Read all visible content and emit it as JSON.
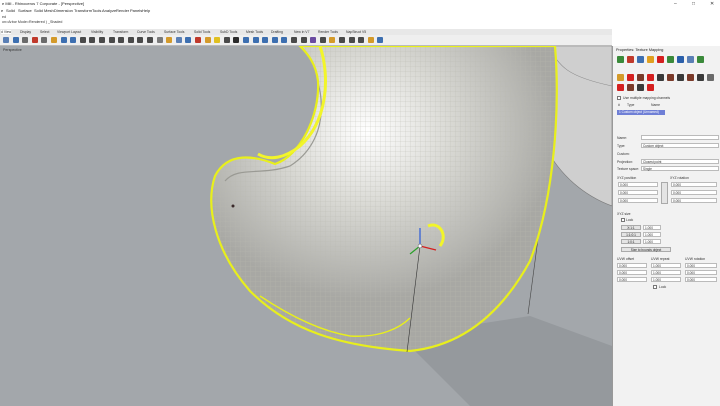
{
  "window": {
    "title": "e Mill - Rhinoceros 7 Corporate - [Perspective]",
    "controls": [
      "–",
      "□",
      "✕"
    ]
  },
  "menu": [
    "e",
    "Solid",
    "Surface",
    "Solid",
    "Mesh",
    "Dimension",
    "Transform",
    "Tools",
    "Analyze",
    "Render",
    "Panels",
    "Help"
  ],
  "command": {
    "line1": "ed",
    "line2": "on=Arbor Mode=Rendered ) _Shaded"
  },
  "tabs": [
    "d View",
    "Display",
    "Select",
    "Viewport Layout",
    "Visibility",
    "Transform",
    "Curve Tools",
    "Surface Tools",
    "Solid Tools",
    "SubD Tools",
    "Mesh Tools",
    "Drafting",
    "New in V7",
    "Render Tools",
    "NapStruct V5"
  ],
  "toolbar": {
    "icon_names": [
      "open-file-icon",
      "save-icon",
      "print-icon",
      "cut-icon",
      "copy-icon",
      "paste-icon",
      "undo-icon",
      "redo-icon",
      "pan-icon",
      "rotate-view-icon",
      "zoom-icon",
      "zoom-window-icon",
      "zoom-extents-icon",
      "zoom-selected-icon",
      "undo-view-icon",
      "four-views-icon",
      "grid-icon",
      "layer-icon",
      "properties-icon",
      "display-mode-icon",
      "render-icon",
      "material-icon",
      "light-icon",
      "filter-icon",
      "point-icon",
      "curve-icon",
      "surface-icon",
      "solid-icon",
      "mesh-icon",
      "subd-icon",
      "dimension-icon",
      "text-icon",
      "block-icon",
      "group-icon",
      "lock-icon",
      "hide-icon",
      "show-icon",
      "select-icon",
      "snap-icon",
      "gumball-icon"
    ],
    "colors": [
      "#5a7fb5",
      "#3d6fb0",
      "#6a6a6a",
      "#c0392b",
      "#6a6a6a",
      "#d49a2a",
      "#3d6fb0",
      "#3d6fb0",
      "#4a4a4a",
      "#4a4a4a",
      "#4a4a4a",
      "#4a4a4a",
      "#4a4a4a",
      "#4a4a4a",
      "#4a4a4a",
      "#4a4a4a",
      "#7a7a7a",
      "#d49a2a",
      "#5a7fb5",
      "#3d6fb0",
      "#c0392b",
      "#d49a2a",
      "#e0c020",
      "#4a4a4a",
      "#2a2a2a",
      "#3d6fb0",
      "#3d6fb0",
      "#3d6fb0",
      "#3d6fb0",
      "#3d6fb0",
      "#4a4a4a",
      "#4a4a4a",
      "#6a4aa0",
      "#4a4a4a",
      "#d49a2a",
      "#4a4a4a",
      "#4a4a4a",
      "#4a4a4a",
      "#d49a2a",
      "#3d6fb0"
    ]
  },
  "viewport": {
    "label": "Perspective"
  },
  "panel": {
    "header": "Properties: Texture Mapping",
    "row1_icons": [
      "object-icon",
      "material-icon",
      "texture-icon",
      "decal-icon",
      "sun-icon",
      "ground-icon",
      "globe-icon",
      "render-icon",
      "check-icon"
    ],
    "row1_colors": [
      "#3a8a3a",
      "#c0392b",
      "#3d6fb0",
      "#e0a020",
      "#d42020",
      "#3a8a3a",
      "#2a5faa",
      "#5a7fb5",
      "#3a8a3a"
    ],
    "row2_icons": [
      "texture-mapping-icon",
      "ring-icon",
      "plane-icon",
      "box-icon",
      "sphere-icon",
      "cylinder-icon",
      "uv-icon",
      "surface-icon",
      "camera-icon",
      "settings-icon"
    ],
    "row2_colors": [
      "#d49a2a",
      "#d42020",
      "#7a3a2a",
      "#d42020",
      "#3a3a3a",
      "#7a3a2a",
      "#3a3a3a",
      "#7a3a2a",
      "#3a3a3a",
      "#6a6a6a"
    ],
    "row3_icons": [
      "add-icon",
      "remove-icon",
      "refresh-icon",
      "delete-icon"
    ],
    "row3_colors": [
      "#d42020",
      "#7a3a2a",
      "#3a3a3a",
      "#d42020"
    ],
    "use_multiple_label": "Use multiple mapping channels",
    "list_headers": [
      "#",
      "Type",
      "Name"
    ],
    "list_row": "1   Custom object  (Unnamed)",
    "name_label": "Name:",
    "type_label": "Type:",
    "type_value": "Custom object",
    "custom_label": "Custom:",
    "projection_label": "Projection:",
    "projection_value": "Closest point",
    "texture_space_label": "Texture space:",
    "texture_space_value": "Single",
    "xyz_position_label": "XYZ position",
    "xyz_rotation_label": "XYZ rotation",
    "pos_values": [
      "0.000",
      "0.000",
      "0.000"
    ],
    "rot_values": [
      "0.000",
      "0.000",
      "0.000"
    ],
    "xyz_size_label": "XYZ size",
    "lock_label": "Lock",
    "size_buttons": [
      "X:1:1",
      "1:1:0:1",
      "1:0:1"
    ],
    "size_values": [
      "1.000",
      "1.000",
      "1.000"
    ],
    "size_to_object_label": "Size to bounds object",
    "uvw_offset_label": "UVW offset",
    "uvw_repeat_label": "UVW repeat",
    "uvw_rotation_label": "UVW rotation",
    "offset_values": [
      "0.000",
      "0.000",
      "0.000"
    ],
    "repeat_values": [
      "1.000",
      "1.000",
      "1.000"
    ],
    "uvw_rot_values": [
      "0.000",
      "0.000",
      "0.000"
    ],
    "uvw_lock_label": "Lock"
  },
  "colors": {
    "viewport_bg": "#a3a7ab",
    "mesh_yellow": "#e8ef1c",
    "surface_grey": "#c9c9c4",
    "selection_blue": "#6f7fd6"
  }
}
